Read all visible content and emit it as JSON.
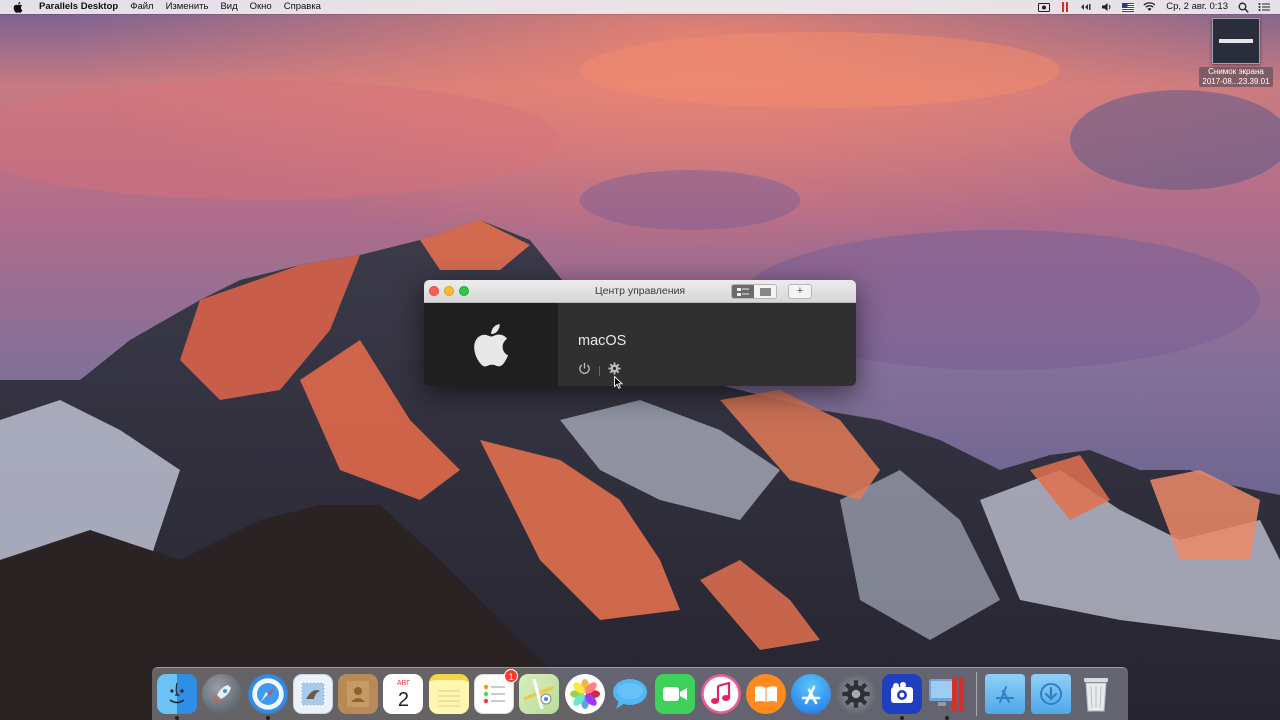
{
  "menubar": {
    "app_name": "Parallels Desktop",
    "items": [
      "Файл",
      "Изменить",
      "Вид",
      "Окно",
      "Справка"
    ],
    "clock": "Ср, 2 авг.  0:13",
    "status_icons": [
      "screen-record-icon",
      "parallels-icon",
      "battery-icon",
      "sound-icon",
      "flag-icon",
      "wifi-icon"
    ]
  },
  "desktop": {
    "file_label_1": "Снимок экрана",
    "file_label_2": "2017-08...23.39.01"
  },
  "window": {
    "title": "Центр управления",
    "add_label": "+",
    "vm": {
      "name": "macOS"
    }
  },
  "dock": {
    "calendar_month": "АВГ",
    "calendar_day": "2",
    "reminders_badge": "1",
    "apps": [
      "Finder",
      "Launchpad",
      "Safari",
      "Mail",
      "Contacts",
      "Calendar",
      "Notes",
      "Reminders",
      "Maps",
      "Photos",
      "Messages",
      "FaceTime",
      "iTunes",
      "iBooks",
      "App Store",
      "System Preferences",
      "Photo Booth",
      "Parallels Desktop",
      "Parallels Control",
      "Applications",
      "Downloads",
      "Trash"
    ]
  },
  "colors": {
    "window_dark": "#2f302f",
    "thumb_dark": "#1f1f1f",
    "close": "#fc5f57",
    "minimize": "#fdbc2e",
    "maximize": "#33c748"
  }
}
